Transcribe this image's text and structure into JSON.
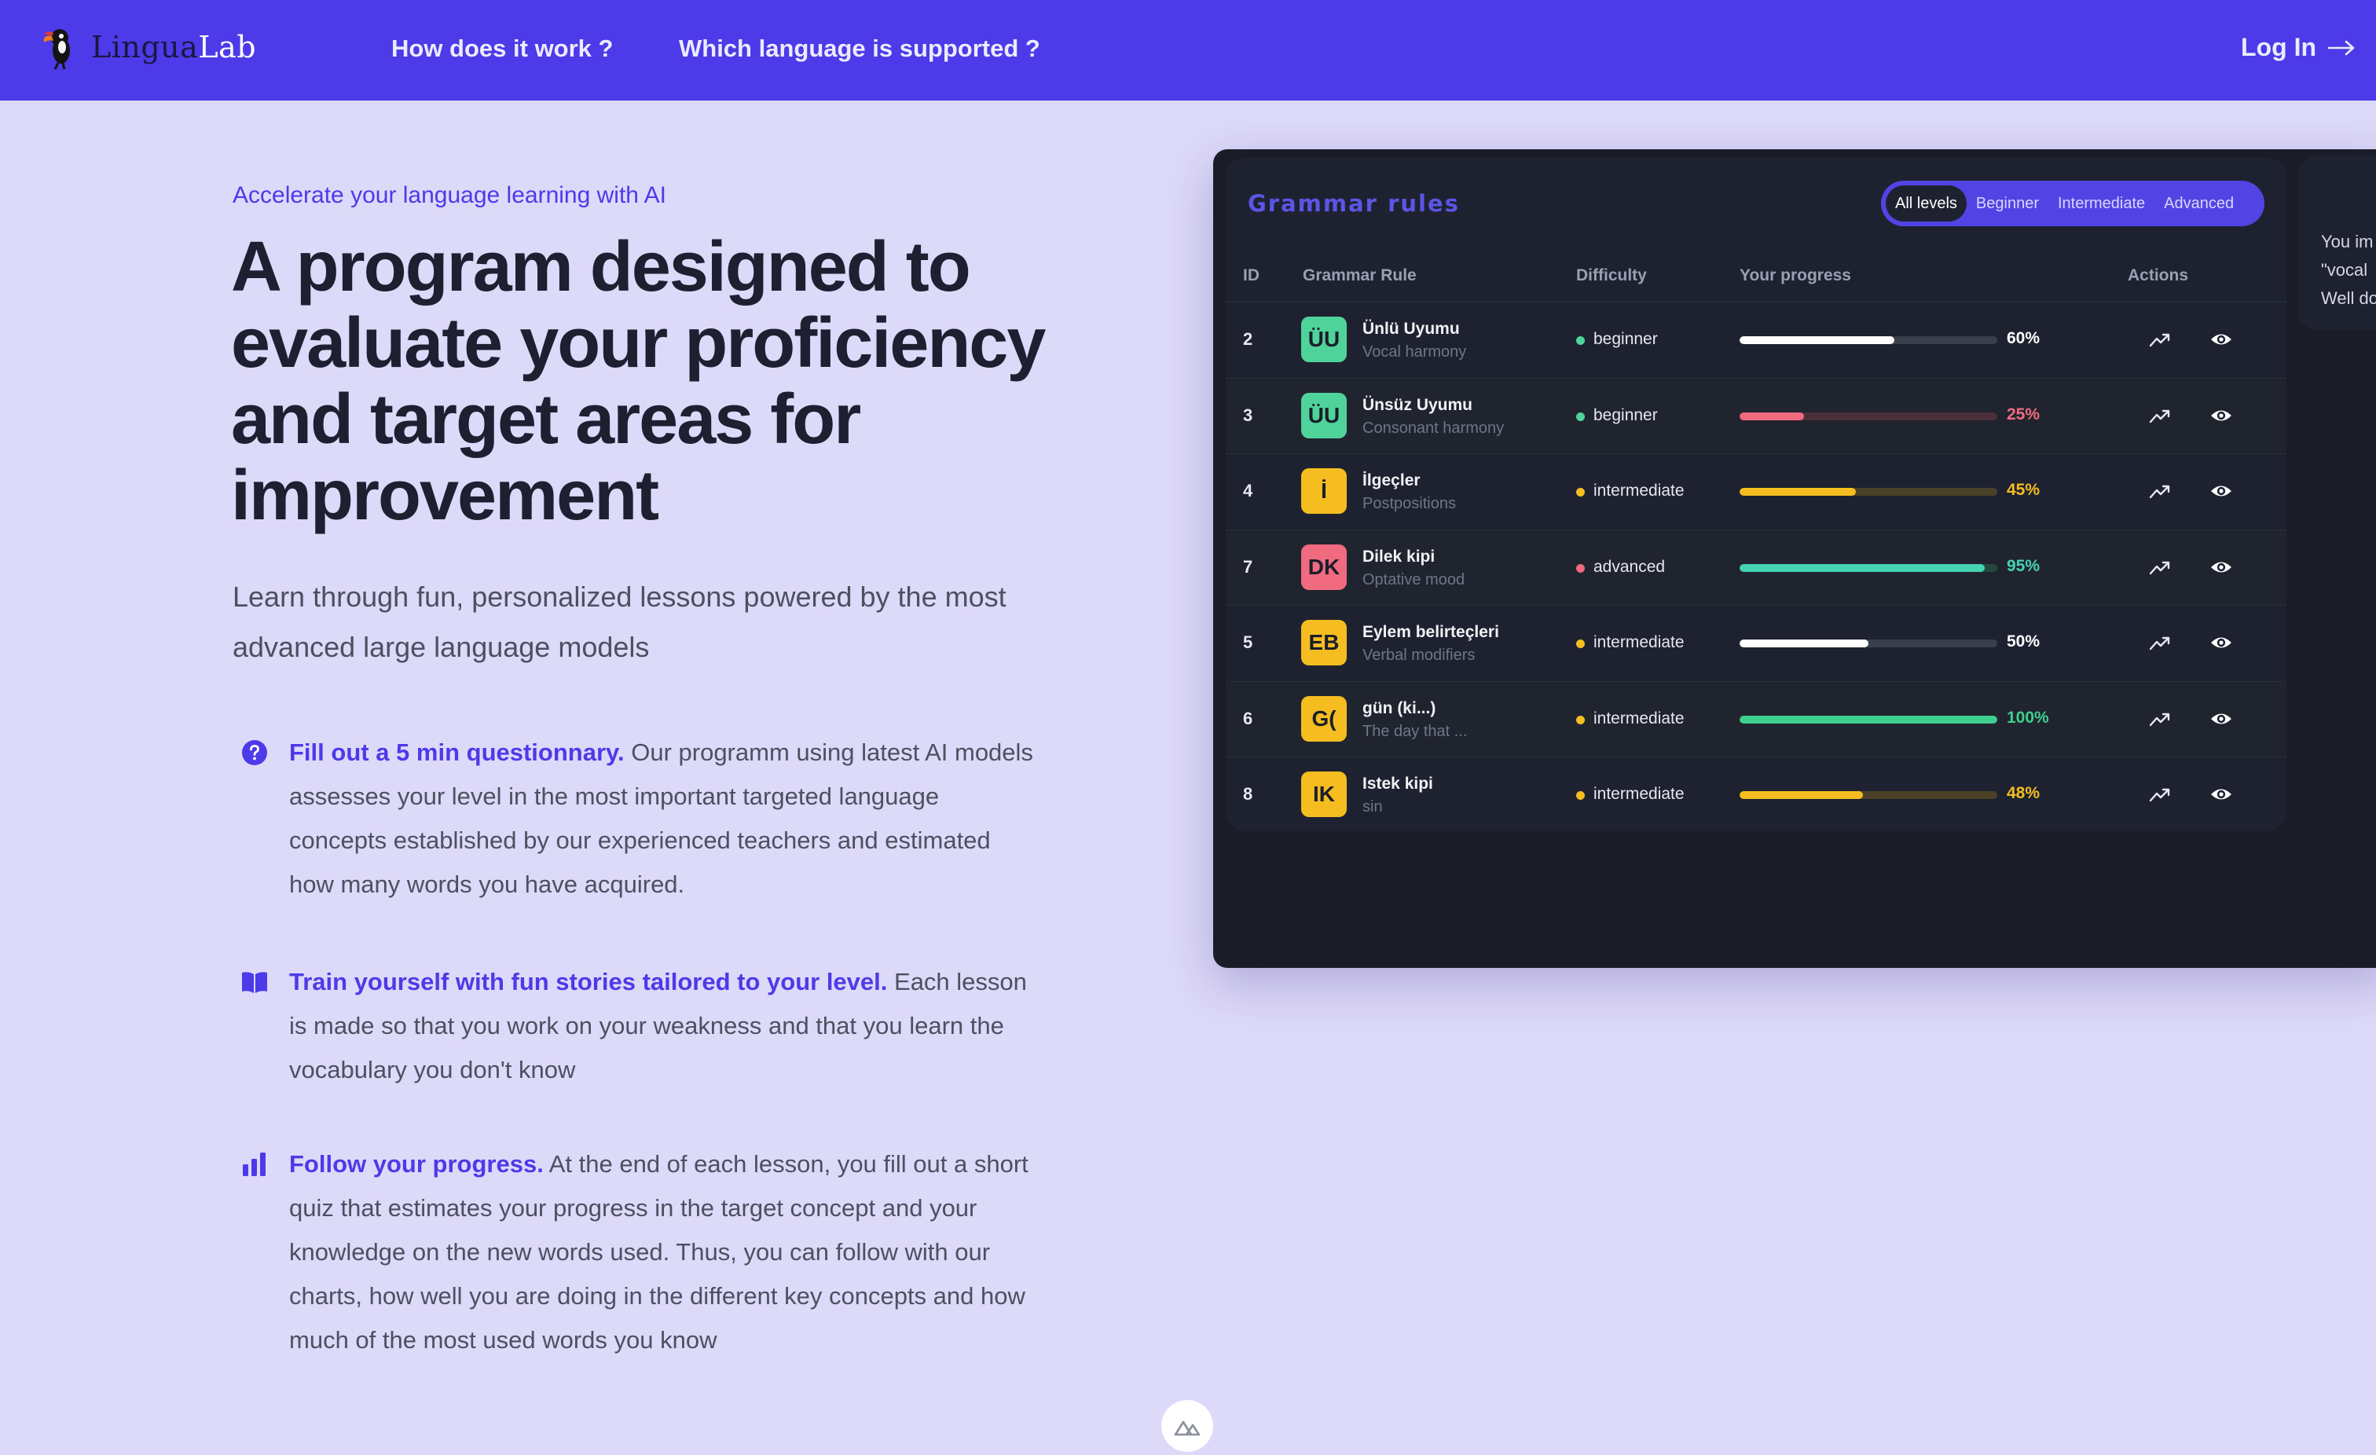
{
  "nav": {
    "logo_word1": "Lingua",
    "logo_word2": "Lab",
    "link_how": "How does it work ?",
    "link_languages": "Which language is supported ?",
    "login": "Log In",
    "login_icon": "arrow-right-icon",
    "logo_icon": "toucan-icon"
  },
  "hero": {
    "eyebrow": "Accelerate your language learning with AI",
    "headline": "A program designed to evaluate your proficiency and target areas for improvement",
    "subtitle": "Learn through fun, personalized lessons powered by the most advanced large language models"
  },
  "features": [
    {
      "icon": "question-circle-icon",
      "title": "Fill out a 5 min questionnary.",
      "text": "Our programm using latest AI models assesses your level in the most important targeted language concepts established by our experienced teachers and estimated how many words you have acquired."
    },
    {
      "icon": "open-book-icon",
      "title": "Train yourself with fun stories tailored to your level.",
      "text": "Each lesson is made so that you work on your weakness and that you learn the vocabulary you don't know"
    },
    {
      "icon": "bar-chart-icon",
      "title": "Follow your progress.",
      "text": "At the end of each lesson, you fill out a short quiz that estimates your progress in the target concept and your knowledge on the new words used. Thus, you can follow with our charts, how well you are doing in the different key concepts and how much of the most used words you know"
    }
  ],
  "grammar": {
    "title": "Grammar rules",
    "filters": [
      "All levels",
      "Beginner",
      "Intermediate",
      "Advanced"
    ],
    "active_filter": "All levels",
    "columns": {
      "id": "ID",
      "rule": "Grammar Rule",
      "difficulty": "Difficulty",
      "progress": "Your progress",
      "actions": "Actions"
    },
    "level_colors": {
      "beginner": "#4fd39a",
      "intermediate": "#f5bd1f",
      "advanced": "#f06a80"
    },
    "rows": [
      {
        "id": "2",
        "badge": "ÜU",
        "name": "Ünlü Uyumu",
        "sub": "Vocal harmony",
        "difficulty": "beginner",
        "progress": 60,
        "pct": "60%",
        "bar_color": "#ffffff",
        "track_color": "#3a3f4c",
        "pct_color": "#ffffff",
        "badge_color": "#4fd39a"
      },
      {
        "id": "3",
        "badge": "ÜU",
        "name": "Ünsüz Uyumu",
        "sub": "Consonant harmony",
        "difficulty": "beginner",
        "progress": 25,
        "pct": "25%",
        "bar_color": "#f06a80",
        "track_color": "#4a2e38",
        "pct_color": "#f06a80",
        "badge_color": "#4fd39a"
      },
      {
        "id": "4",
        "badge": "İ",
        "name": "İlgeçler",
        "sub": "Postpositions",
        "difficulty": "intermediate",
        "progress": 45,
        "pct": "45%",
        "bar_color": "#f5bd1f",
        "track_color": "#4a4128",
        "pct_color": "#f5bd1f",
        "badge_color": "#f5bd1f"
      },
      {
        "id": "7",
        "badge": "DK",
        "name": "Dilek kipi",
        "sub": "Optative mood",
        "difficulty": "advanced",
        "progress": 95,
        "pct": "95%",
        "bar_color": "#45d3b4",
        "track_color": "#24493f",
        "pct_color": "#45d3b4",
        "badge_color": "#f06a80"
      },
      {
        "id": "5",
        "badge": "EB",
        "name": "Eylem belirteçleri",
        "sub": "Verbal modifiers",
        "difficulty": "intermediate",
        "progress": 50,
        "pct": "50%",
        "bar_color": "#ffffff",
        "track_color": "#3a3f4c",
        "pct_color": "#ffffff",
        "badge_color": "#f5bd1f"
      },
      {
        "id": "6",
        "badge": "G(",
        "name": "gün (ki...)",
        "sub": "The day that ...",
        "difficulty": "intermediate",
        "progress": 100,
        "pct": "100%",
        "bar_color": "#3fcf8e",
        "track_color": "#24493f",
        "pct_color": "#3fcf8e",
        "badge_color": "#f5bd1f"
      },
      {
        "id": "8",
        "badge": "IK",
        "name": "Istek kipi",
        "sub": "sin",
        "difficulty": "intermediate",
        "progress": 48,
        "pct": "48%",
        "bar_color": "#f5bd1f",
        "track_color": "#4a4128",
        "pct_color": "#f5bd1f",
        "badge_color": "#f5bd1f"
      }
    ],
    "action_icons": [
      "trend-up-icon",
      "eye-icon"
    ]
  },
  "side_card": {
    "lines": [
      "You im",
      "\"vocal",
      "Well do"
    ]
  },
  "colors": {
    "accent": "#4d3ae8",
    "background": "#ddd9f9",
    "panel": "#1a1d27"
  },
  "footer_icon": "nuxt-logo-icon"
}
